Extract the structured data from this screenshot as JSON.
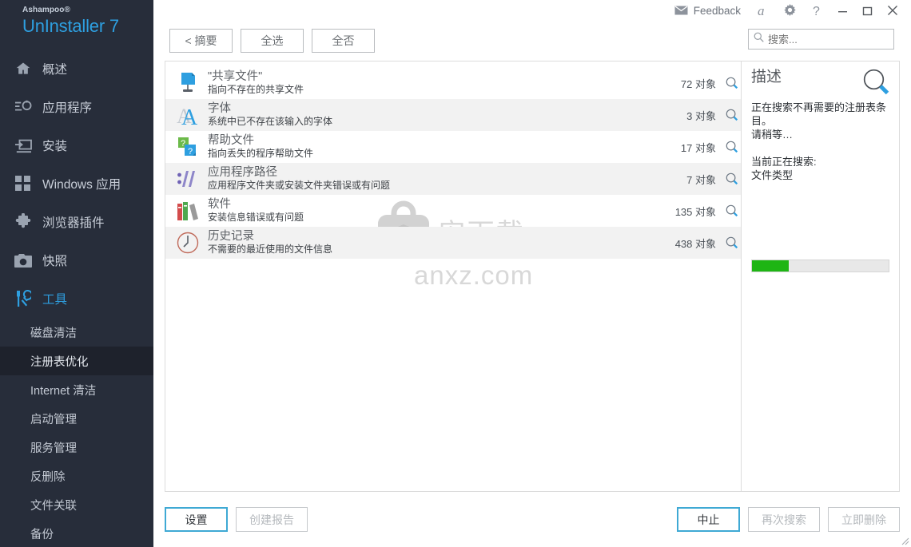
{
  "brand": {
    "sup": "Ashampoo®",
    "name": "UnInstaller 7",
    "accent": "#2e9fe0"
  },
  "titlebar": {
    "feedback_label": "Feedback",
    "icons": [
      "mail-icon",
      "ashampoo-a-icon",
      "gear-icon",
      "help-icon"
    ],
    "window_controls": [
      "minimize",
      "maximize",
      "close"
    ]
  },
  "sidebar": {
    "items": [
      {
        "label": "概述",
        "icon": "home-icon",
        "active": false
      },
      {
        "label": "应用程序",
        "icon": "apps-icon",
        "active": false
      },
      {
        "label": "安装",
        "icon": "install-icon",
        "active": false
      },
      {
        "label": "Windows 应用",
        "icon": "windows-apps-icon",
        "active": false
      },
      {
        "label": "浏览器插件",
        "icon": "puzzle-icon",
        "active": false
      },
      {
        "label": "快照",
        "icon": "camera-icon",
        "active": false
      },
      {
        "label": "工具",
        "icon": "tools-icon",
        "active": true
      }
    ],
    "sub_items": [
      {
        "label": "磁盘清洁",
        "selected": false
      },
      {
        "label": "注册表优化",
        "selected": true
      },
      {
        "label": "Internet 清洁",
        "selected": false
      },
      {
        "label": "启动管理",
        "selected": false
      },
      {
        "label": "服务管理",
        "selected": false
      },
      {
        "label": "反删除",
        "selected": false
      },
      {
        "label": "文件关联",
        "selected": false
      },
      {
        "label": "备份",
        "selected": false
      }
    ]
  },
  "toolbar": {
    "summary_label": "< 摘要",
    "select_all_label": "全选",
    "select_none_label": "全否"
  },
  "search": {
    "placeholder": "搜索...",
    "value": ""
  },
  "list": {
    "count_suffix": "对象",
    "rows": [
      {
        "icon": "shared-file-icon",
        "title": "\"共享文件\"",
        "subtitle": "指向不存在的共享文件",
        "count": "72 对象"
      },
      {
        "icon": "font-icon",
        "title": "字体",
        "subtitle": "系统中已不存在该输入的字体",
        "count": "3 对象"
      },
      {
        "icon": "help-file-icon",
        "title": "帮助文件",
        "subtitle": "指向丢失的程序帮助文件",
        "count": "17 对象"
      },
      {
        "icon": "app-path-icon",
        "title": "应用程序路径",
        "subtitle": "应用程序文件夹或安装文件夹错误或有问题",
        "count": "7 对象"
      },
      {
        "icon": "software-icon",
        "title": "软件",
        "subtitle": "安装信息错误或有问题",
        "count": "135 对象"
      },
      {
        "icon": "history-icon",
        "title": "历史记录",
        "subtitle": "不需要的最近使用的文件信息",
        "count": "438 对象"
      }
    ]
  },
  "watermark": {
    "logo_glyph": "安",
    "text_cn": "安下载",
    "text_url": "anxz.com"
  },
  "description": {
    "title": "描述",
    "body": "正在搜索不再需要的注册表条目。\n请稍等…",
    "body2": "当前正在搜索:\n文件类型",
    "progress_percent": 27,
    "progress_color": "#1eb514"
  },
  "footer": {
    "settings_label": "设置",
    "create_report_label": "创建报告",
    "abort_label": "中止",
    "search_again_label": "再次搜索",
    "delete_now_label": "立即删除",
    "primary_color": "#3fa9d4"
  }
}
